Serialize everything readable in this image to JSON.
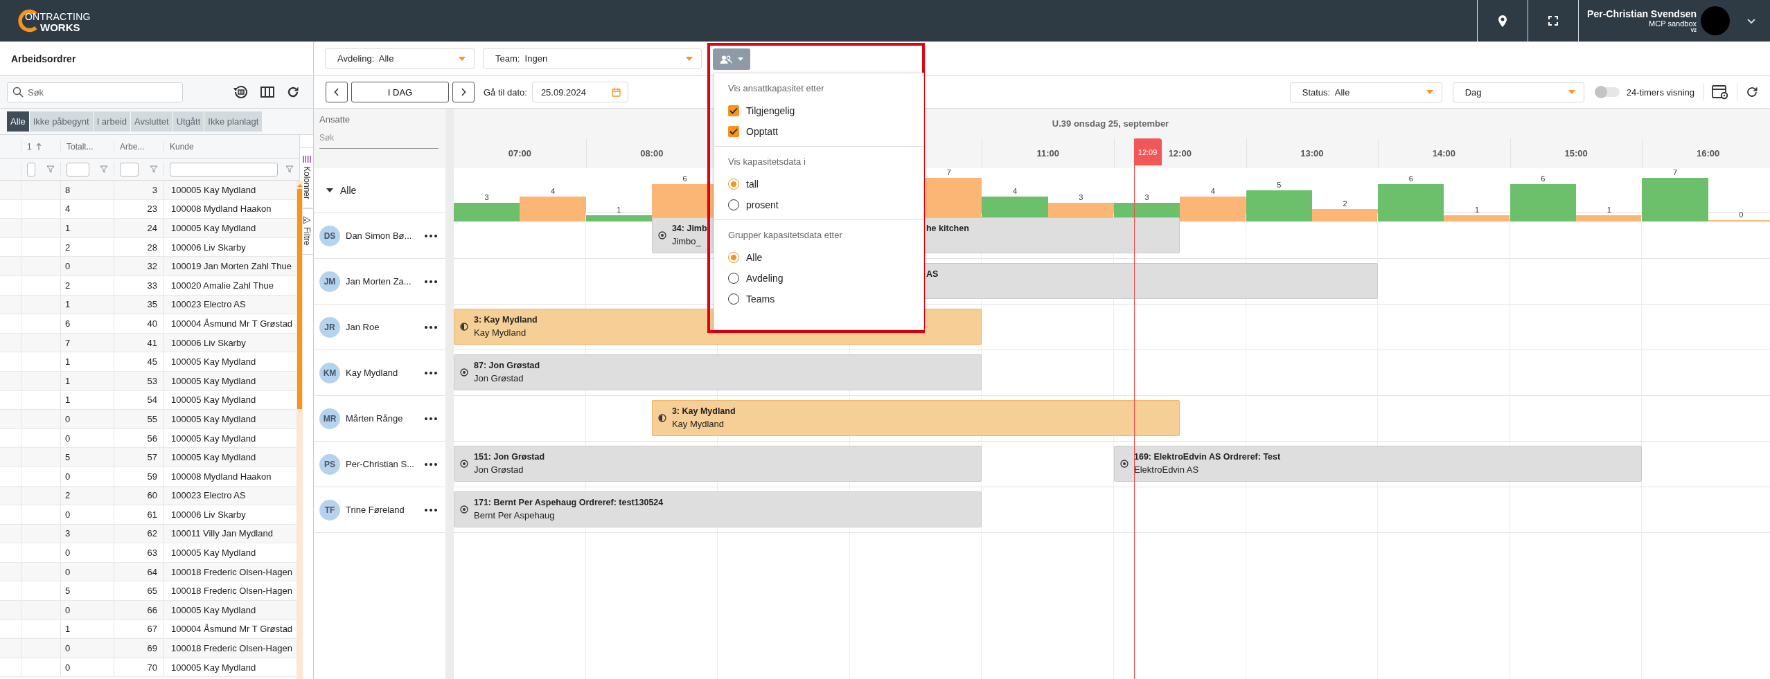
{
  "app": {
    "logo_main": "ONTRACTING",
    "logo_sub": "WORKS"
  },
  "header": {
    "user_name": "Per-Christian Svendsen",
    "tenant": "MCP sandbox",
    "version": "V2"
  },
  "work_orders": {
    "title": "Arbeidsordrer",
    "search": {
      "placeholder": "Søk"
    },
    "tabs": [
      {
        "label": "Alle",
        "selected": true
      },
      {
        "label": "Ikke påbegynt",
        "selected": false
      },
      {
        "label": "I arbeid",
        "selected": false
      },
      {
        "label": "Avsluttet",
        "selected": false
      },
      {
        "label": "Utgått",
        "selected": false
      },
      {
        "label": "Ikke planlagt",
        "selected": false
      }
    ],
    "columns": [
      {
        "label": "1",
        "sorted": true
      },
      {
        "label": "Totalt...",
        "sorted": false
      },
      {
        "label": "Arbe...",
        "sorted": false
      },
      {
        "label": "Kunde",
        "sorted": false
      }
    ],
    "rows": [
      {
        "total": "8",
        "number": "3",
        "customer": "100005 Kay Mydland"
      },
      {
        "total": "4",
        "number": "23",
        "customer": "100008 Mydland Haakon"
      },
      {
        "total": "1",
        "number": "24",
        "customer": "100005 Kay Mydland"
      },
      {
        "total": "2",
        "number": "28",
        "customer": "100006 Liv Skarby"
      },
      {
        "total": "0",
        "number": "32",
        "customer": "100019 Jan Morten Zahl Thue"
      },
      {
        "total": "2",
        "number": "33",
        "customer": "100020 Amalie Zahl Thue"
      },
      {
        "total": "1",
        "number": "35",
        "customer": "100023 Electro AS"
      },
      {
        "total": "6",
        "number": "40",
        "customer": "100004 Åsmund Mr T Grøstad"
      },
      {
        "total": "7",
        "number": "41",
        "customer": "100006 Liv Skarby"
      },
      {
        "total": "1",
        "number": "45",
        "customer": "100005 Kay Mydland"
      },
      {
        "total": "1",
        "number": "53",
        "customer": "100005 Kay Mydland"
      },
      {
        "total": "1",
        "number": "54",
        "customer": "100005 Kay Mydland"
      },
      {
        "total": "0",
        "number": "55",
        "customer": "100005 Kay Mydland"
      },
      {
        "total": "0",
        "number": "56",
        "customer": "100005 Kay Mydland"
      },
      {
        "total": "5",
        "number": "57",
        "customer": "100005 Kay Mydland"
      },
      {
        "total": "0",
        "number": "59",
        "customer": "100008 Mydland Haakon"
      },
      {
        "total": "2",
        "number": "60",
        "customer": "100023 Electro AS"
      },
      {
        "total": "0",
        "number": "61",
        "customer": "100006 Liv Skarby"
      },
      {
        "total": "3",
        "number": "62",
        "customer": "100011 Villy Jan Mydland"
      },
      {
        "total": "0",
        "number": "63",
        "customer": "100005 Kay Mydland"
      },
      {
        "total": "0",
        "number": "64",
        "customer": "100018 Frederic Olsen-Hagen"
      },
      {
        "total": "5",
        "number": "65",
        "customer": "100018 Frederic Olsen-Hagen"
      },
      {
        "total": "0",
        "number": "66",
        "customer": "100005 Kay Mydland"
      },
      {
        "total": "1",
        "number": "67",
        "customer": "100004 Åsmund Mr T Grøstad"
      },
      {
        "total": "0",
        "number": "69",
        "customer": "100018 Frederic Olsen-Hagen"
      },
      {
        "total": "0",
        "number": "70",
        "customer": "100005 Kay Mydland"
      }
    ],
    "side_tabs": [
      "Kolonner",
      "Filtre"
    ]
  },
  "planner": {
    "filters": [
      {
        "label": "Avdeling:",
        "value": "Alle"
      },
      {
        "label": "Team:",
        "value": "Ingen"
      }
    ],
    "today": "I DAG",
    "goto_label": "Gå til dato:",
    "date": "25.09.2024",
    "status": {
      "label": "Status:",
      "value": "Alle"
    },
    "view": "Dag",
    "toggle": {
      "label": "24-timers visning",
      "on": false
    },
    "employees_label": "Ansatte",
    "employee_search": {
      "placeholder": "Søk"
    },
    "group": {
      "label": "Alle",
      "expanded": true
    },
    "date_title": "U.39 onsdag 25, september",
    "now": "12:09",
    "hours": [
      {
        "label": "07:00",
        "available": "3",
        "busy": "4"
      },
      {
        "label": "08:00",
        "available": "1",
        "busy": "6"
      },
      {
        "busy": "7"
      },
      {
        "label": "11:00",
        "available": "4",
        "busy": "3"
      },
      {
        "label": "12:00",
        "available": "3",
        "busy": "4"
      },
      {
        "label": "13:00",
        "available": "5",
        "busy": "2"
      },
      {
        "label": "14:00",
        "available": "6",
        "busy": "1"
      },
      {
        "label": "15:00",
        "available": "6",
        "busy": "1"
      },
      {
        "label": "16:00",
        "available": "7",
        "busy": "0"
      }
    ],
    "employees": [
      {
        "initials": "DS",
        "name": "Dan Simon Bø...",
        "tasks": [
          {
            "kind": "planned",
            "title": "34: Jimb",
            "subtitle": "Jimbo_",
            "tail": "he kitchen"
          }
        ]
      },
      {
        "initials": "JM",
        "name": "Jan Morten Za...",
        "tasks": [
          {
            "kind": "planned",
            "tail": "AS"
          }
        ]
      },
      {
        "initials": "JR",
        "name": "Jan Roe",
        "tasks": [
          {
            "kind": "in_progress",
            "title": "3: Kay Mydland",
            "subtitle": "Kay Mydland"
          }
        ]
      },
      {
        "initials": "KM",
        "name": "Kay Mydland",
        "tasks": [
          {
            "kind": "planned",
            "title": "87: Jon Grøstad",
            "subtitle": "Jon Grøstad"
          }
        ]
      },
      {
        "initials": "MR",
        "name": "Mårten Rånge",
        "tasks": [
          {
            "kind": "in_progress",
            "title": "3: Kay Mydland",
            "subtitle": "Kay Mydland"
          }
        ]
      },
      {
        "initials": "PS",
        "name": "Per-Christian S...",
        "tasks": [
          {
            "kind": "planned",
            "title": "151: Jon Grøstad",
            "subtitle": "Jon Grøstad"
          },
          {
            "kind": "planned",
            "title": "169: ElektroEdvin AS Ordreref: Test",
            "subtitle": "ElektroEdvin AS"
          }
        ]
      },
      {
        "initials": "TF",
        "name": "Trine Føreland",
        "tasks": [
          {
            "kind": "planned",
            "title": "171: Bernt Per Aspehaug Ordreref: test130524",
            "subtitle": "Bernt Per Aspehaug"
          }
        ]
      }
    ]
  },
  "capacity_menu": {
    "sections": [
      {
        "heading": "Vis ansattkapasitet etter",
        "kind": "checkbox",
        "options": [
          {
            "label": "Tilgjengelig",
            "checked": true
          },
          {
            "label": "Opptatt",
            "checked": true
          }
        ]
      },
      {
        "heading": "Vis kapasitetsdata i",
        "kind": "radio",
        "options": [
          {
            "label": "tall",
            "selected": true
          },
          {
            "label": "prosent",
            "selected": false
          }
        ]
      },
      {
        "heading": "Grupper kapasitetsdata etter",
        "kind": "radio",
        "options": [
          {
            "label": "Alle",
            "selected": true
          },
          {
            "label": "Avdeling",
            "selected": false
          },
          {
            "label": "Teams",
            "selected": false
          }
        ]
      }
    ]
  }
}
